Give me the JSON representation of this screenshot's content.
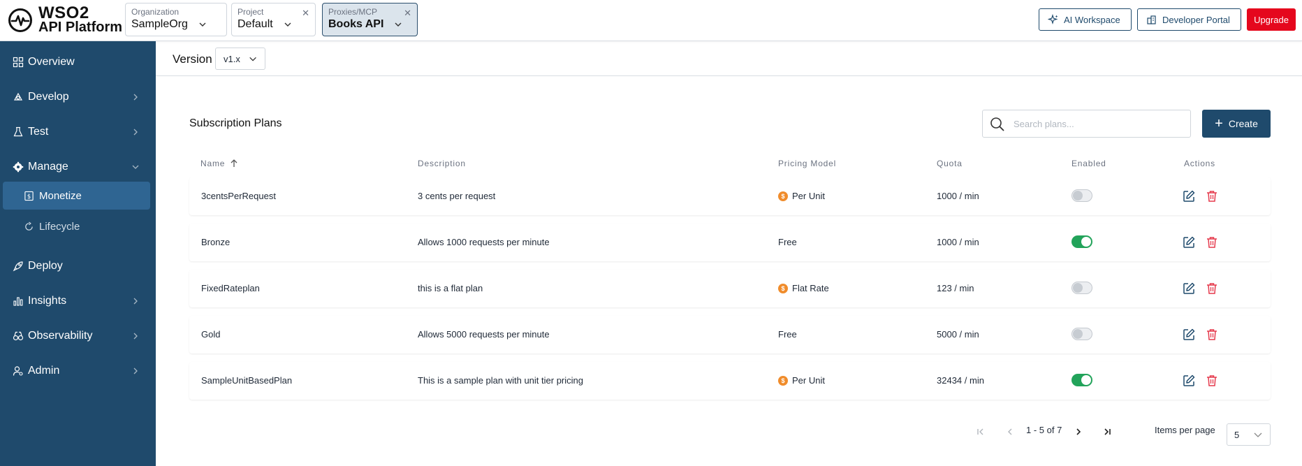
{
  "brand": {
    "line1": "WSO2",
    "line2": "API Platform"
  },
  "selectors": {
    "organization": {
      "label": "Organization",
      "value": "SampleOrg"
    },
    "project": {
      "label": "Project",
      "value": "Default"
    },
    "proxies": {
      "label": "Proxies/MCP",
      "value": "Books API"
    }
  },
  "topbar": {
    "ai_workspace": "AI Workspace",
    "developer_portal": "Developer Portal",
    "upgrade": "Upgrade"
  },
  "sidebar": {
    "items": [
      {
        "label": "Overview"
      },
      {
        "label": "Develop"
      },
      {
        "label": "Test"
      },
      {
        "label": "Manage"
      },
      {
        "label": "Monetize"
      },
      {
        "label": "Lifecycle"
      },
      {
        "label": "Deploy"
      },
      {
        "label": "Insights"
      },
      {
        "label": "Observability"
      },
      {
        "label": "Admin"
      }
    ]
  },
  "version": {
    "label": "Version",
    "value": "v1.x"
  },
  "plans": {
    "title": "Subscription Plans",
    "search_placeholder": "Search plans...",
    "create_label": "Create",
    "columns": [
      "Name",
      "Description",
      "Pricing Model",
      "Quota",
      "Enabled",
      "Actions"
    ],
    "rows": [
      {
        "name": "3centsPerRequest",
        "description": "3 cents per request",
        "pricing": "Per Unit",
        "paid": true,
        "quota": "1000 / min",
        "enabled": false
      },
      {
        "name": "Bronze",
        "description": "Allows 1000 requests per minute",
        "pricing": "Free",
        "paid": false,
        "quota": "1000 / min",
        "enabled": true
      },
      {
        "name": "FixedRateplan",
        "description": "this is a flat plan",
        "pricing": "Flat Rate",
        "paid": true,
        "quota": "123 / min",
        "enabled": false
      },
      {
        "name": "Gold",
        "description": "Allows 5000 requests per minute",
        "pricing": "Free",
        "paid": false,
        "quota": "5000 / min",
        "enabled": false
      },
      {
        "name": "SampleUnitBasedPlan",
        "description": "This is a sample plan with unit tier pricing",
        "pricing": "Per Unit",
        "paid": true,
        "quota": "32434 / min",
        "enabled": true
      }
    ]
  },
  "pagination": {
    "range": "1 - 5 of 7",
    "items_per_page_label": "Items per page",
    "items_per_page": "5"
  },
  "colors": {
    "sidebar": "#1f4a6c",
    "selected": "#2f6592",
    "upgrade": "#e5071d",
    "enabled": "#22a35a",
    "coin": "#f08c2b",
    "delete": "#e5384b"
  }
}
